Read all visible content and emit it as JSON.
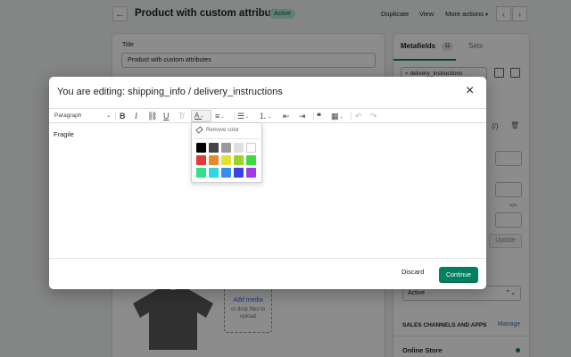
{
  "page": {
    "title": "Product with custom attributes",
    "status_badge": "Active",
    "actions": {
      "duplicate": "Duplicate",
      "view": "View",
      "more": "More actions"
    },
    "title_field": {
      "label": "Title",
      "value": "Product with custom attributes"
    },
    "add_media": {
      "link": "Add media",
      "hint": "or drop files to upload"
    }
  },
  "sidebar": {
    "tabs": {
      "metafields": "Metafields",
      "metafields_count": "11",
      "sets": "Sets"
    },
    "search_value": "delivery_instructions",
    "update_label": "Update",
    "status_value": "Active",
    "channels_heading": "SALES CHANNELS AND APPS",
    "manage_link": "Manage",
    "online_store": "Online Store"
  },
  "modal": {
    "title": "You are editing: shipping_info / delivery_instructions",
    "close_icon": "close-icon",
    "toolbar": {
      "paragraph": "Paragraph"
    },
    "editor_content": "Fragile",
    "color_picker": {
      "remove_label": "Remove color",
      "swatches": [
        "#000000",
        "#444444",
        "#999999",
        "#e0e0e0",
        "#ffffff",
        "#e53935",
        "#e68a2e",
        "#e5e22e",
        "#9ad32a",
        "#3ddc3d",
        "#2ee08a",
        "#2ed8e0",
        "#3390ee",
        "#3a43e6",
        "#a13ae6"
      ]
    },
    "footer": {
      "discard": "Discard",
      "continue": "Continue"
    }
  },
  "colors": {
    "primary": "#008060",
    "link": "#2c6ecb",
    "overlay": "rgba(0,0,0,0.45)"
  }
}
